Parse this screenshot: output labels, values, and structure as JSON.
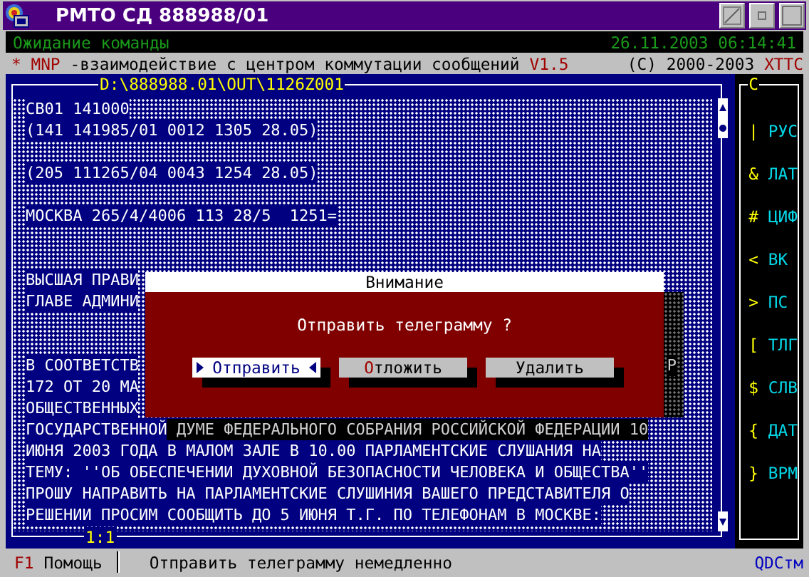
{
  "window": {
    "title": "РМТО СД 888988/01"
  },
  "status_line": {
    "state": "Ожидание команды",
    "datetime": "26.11.2003 06:14:41"
  },
  "info_line": {
    "left": [
      {
        "text": "* MNP",
        "kind": "accent"
      },
      {
        "text": "-взаимодействие с центром коммутации сообщений",
        "kind": "plain"
      },
      {
        "text": "V1.5",
        "kind": "accent"
      }
    ],
    "right": [
      {
        "text": "(C) 2000-2003",
        "kind": "plain"
      },
      {
        "text": "XTTC",
        "kind": "accent"
      }
    ]
  },
  "editor": {
    "path": "D:\\888988.01\\OUT\\1126Z001",
    "position": "1:1",
    "lines": [
      {
        "kind": "text",
        "segments": [
          {
            "text": "СВ01 141000",
            "shadowed": false
          }
        ]
      },
      {
        "kind": "text",
        "segments": [
          {
            "text": "(141 141985/01 0012 1305 28.05)",
            "shadowed": false
          }
        ]
      },
      {
        "kind": "blank"
      },
      {
        "kind": "text",
        "segments": [
          {
            "text": "(205 111265/04 0043 1254 28.05)",
            "shadowed": false
          }
        ]
      },
      {
        "kind": "blank"
      },
      {
        "kind": "text",
        "segments": [
          {
            "text": "МОСКВА 265/4/4006 113 28/5  1251=",
            "shadowed": false
          }
        ]
      },
      {
        "kind": "blank"
      },
      {
        "kind": "blank"
      },
      {
        "kind": "text",
        "segments": [
          {
            "text": "ВЫСШАЯ ПРАВИ",
            "shadowed": false
          }
        ]
      },
      {
        "kind": "text",
        "segments": [
          {
            "text": "ГЛАВЕ АДМИНИ",
            "shadowed": false
          }
        ]
      },
      {
        "kind": "blank"
      },
      {
        "kind": "blank"
      },
      {
        "kind": "split",
        "segments": [
          {
            "text": "В СООТВЕТСТВ",
            "shadowed": false
          },
          {
            "text": "Р",
            "shadowed": true
          }
        ]
      },
      {
        "kind": "text",
        "segments": [
          {
            "text": "172 ОТ 20 МА",
            "shadowed": false
          }
        ]
      },
      {
        "kind": "text",
        "segments": [
          {
            "text": "ОБЩЕСТВЕННЫХ",
            "shadowed": false
          }
        ]
      },
      {
        "kind": "text",
        "segments": [
          {
            "text": "ГОСУДАРСТВЕННОЙ",
            "shadowed": false
          },
          {
            "text": " ДУМЕ ФЕДЕРАЛЬНОГО СОБРАНИЯ РОССИЙСКОЙ ФЕДЕРАЦИИ 10",
            "shadowed": true
          }
        ]
      },
      {
        "kind": "text",
        "segments": [
          {
            "text": "ИЮНЯ 2003 ГОДА В МАЛОМ ЗАЛЕ В 10.00 ПАРЛАМЕНТСКИЕ СЛУШАНИЯ НА",
            "shadowed": false
          }
        ]
      },
      {
        "kind": "text",
        "segments": [
          {
            "text": "ТЕМУ: ''ОБ ОБЕСПЕЧЕНИИ ДУХОВНОЙ БЕЗОПАСНОСТИ ЧЕЛОВЕКА И ОБЩЕСТВА''",
            "shadowed": false
          }
        ]
      },
      {
        "kind": "text",
        "segments": [
          {
            "text": "ПРОШУ НАПРАВИТЬ НА ПАРЛАМЕНТСКИЕ СЛУШИНИЯ ВАШЕГО ПРЕДСТАВИТЕЛЯ О",
            "shadowed": false
          }
        ]
      },
      {
        "kind": "text",
        "segments": [
          {
            "text": "РЕШЕНИИ ПРОСИМ СООБЩИТЬ ДО 5 ИЮНЯ Т.Г. ПО ТЕЛЕФОНАМ В МОСКВЕ:",
            "shadowed": false
          }
        ]
      }
    ]
  },
  "side_panel": {
    "title": "C",
    "items": [
      {
        "symbol": "|",
        "label": "РУС"
      },
      {
        "symbol": "&",
        "label": "ЛАТ"
      },
      {
        "symbol": "#",
        "label": "ЦИФ"
      },
      {
        "symbol": "<",
        "label": "ВК"
      },
      {
        "symbol": ">",
        "label": "ПС"
      },
      {
        "symbol": "[",
        "label": "ТЛГ"
      },
      {
        "symbol": "$",
        "label": "СЛВ"
      },
      {
        "symbol": "{",
        "label": "ДАТ"
      },
      {
        "symbol": "}",
        "label": "ВРМ"
      }
    ]
  },
  "dialog": {
    "title": "Внимание",
    "message": "Отправить телеграмму ?",
    "buttons": [
      {
        "label": "Отправить",
        "selected": true,
        "hotkey_marked": false
      },
      {
        "label": "Отложить",
        "selected": false,
        "hotkey_marked": true
      },
      {
        "label": "Удалить",
        "selected": false,
        "hotkey_marked": false
      }
    ]
  },
  "status_bar": {
    "key": "F1",
    "key_label": "Помощь",
    "hint": "Отправить телеграмму немедленно",
    "brand": "QDCтм"
  }
}
